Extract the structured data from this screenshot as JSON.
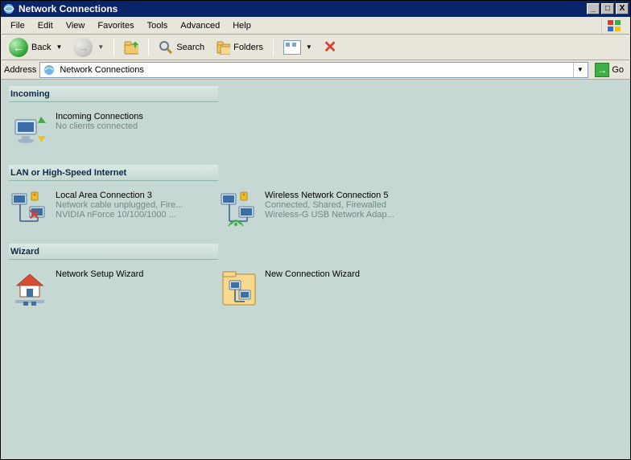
{
  "window": {
    "title": "Network Connections"
  },
  "menu": {
    "file": "File",
    "edit": "Edit",
    "view": "View",
    "favorites": "Favorites",
    "tools": "Tools",
    "advanced": "Advanced",
    "help": "Help"
  },
  "toolbar": {
    "back": "Back",
    "search": "Search",
    "folders": "Folders"
  },
  "addressbar": {
    "label": "Address",
    "value": "Network Connections",
    "go": "Go"
  },
  "sections": {
    "incoming": {
      "header": "Incoming",
      "items": [
        {
          "name": "Incoming Connections",
          "sub1": "No clients connected",
          "sub2": ""
        }
      ]
    },
    "lan": {
      "header": "LAN or High-Speed Internet",
      "items": [
        {
          "name": "Local Area Connection 3",
          "sub1": "Network cable unplugged, Fire...",
          "sub2": "NVIDIA nForce 10/100/1000 ..."
        },
        {
          "name": "Wireless Network Connection 5",
          "sub1": "Connected, Shared, Firewalled",
          "sub2": "Wireless-G USB Network Adap..."
        }
      ]
    },
    "wizard": {
      "header": "Wizard",
      "items": [
        {
          "name": "Network Setup Wizard",
          "sub1": "",
          "sub2": ""
        },
        {
          "name": "New Connection Wizard",
          "sub1": "",
          "sub2": ""
        }
      ]
    }
  }
}
